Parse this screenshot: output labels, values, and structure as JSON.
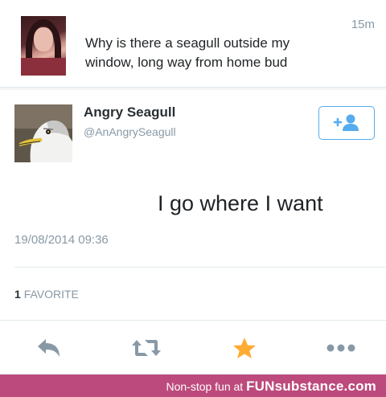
{
  "reply_tweet": {
    "text": "Why is there a seagull outside my window, long way from home bud",
    "time_ago": "15m"
  },
  "main_tweet": {
    "display_name": "Angry Seagull",
    "handle": "@AnAngrySeagull",
    "text": "I go where I want",
    "timestamp": "19/08/2014 09:36",
    "favorite_count": "1",
    "favorite_label": "FAVORITE"
  },
  "footer": {
    "tagline": "Non-stop fun at",
    "brand": "FUNsubstance.com"
  },
  "colors": {
    "accent": "#55acee",
    "favorite_star": "#ffac33",
    "icon_gray": "#8899a6",
    "footer_bg": "#bd4a7c"
  },
  "icons": {
    "reply": "reply-arrow-icon",
    "retweet": "retweet-icon",
    "favorite": "star-icon",
    "more": "more-dots-icon",
    "follow": "add-user-icon"
  }
}
